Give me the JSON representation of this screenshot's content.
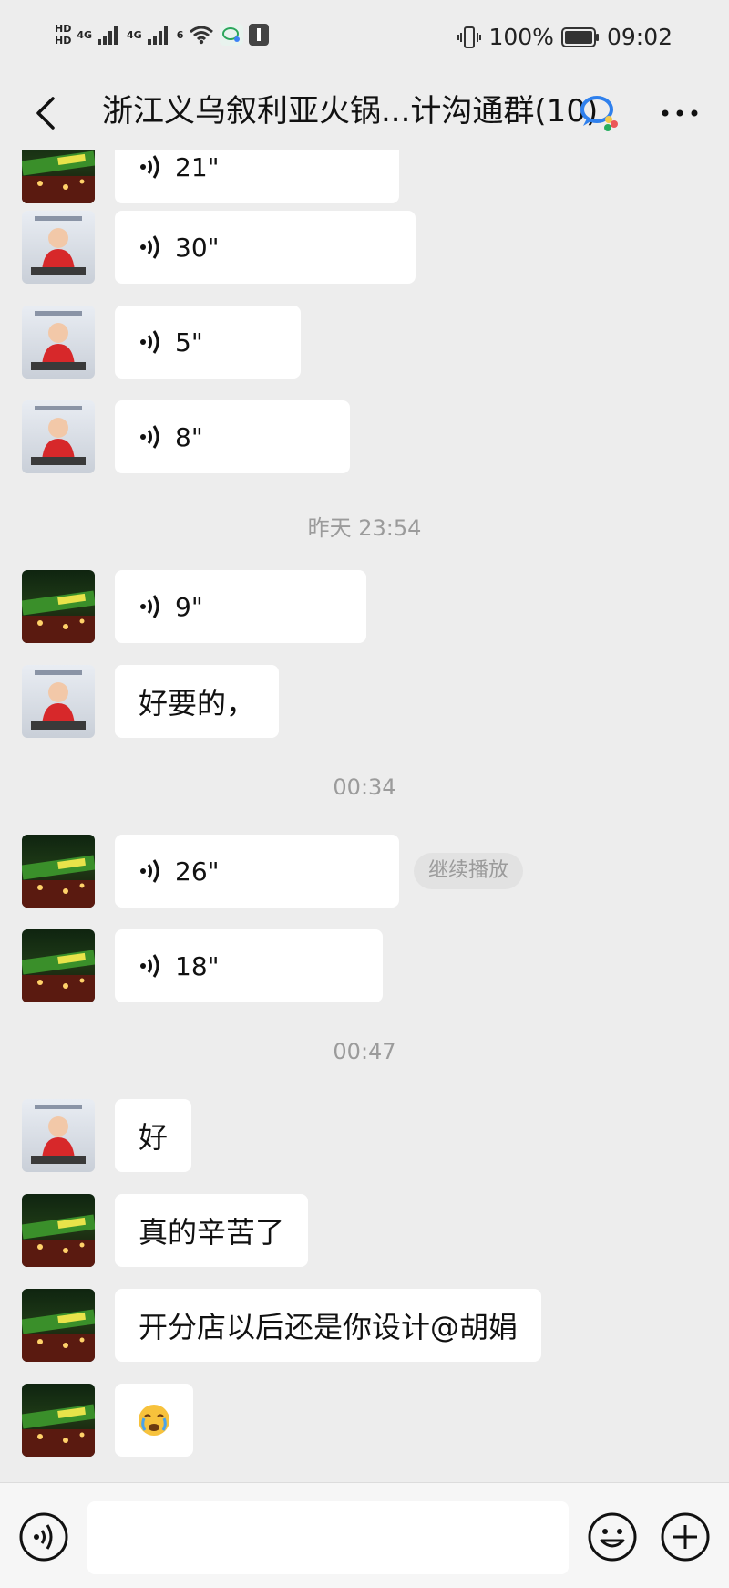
{
  "status_bar": {
    "hd1": "HD",
    "hd2": "HD",
    "net1": "4G",
    "net2": "4G",
    "wifi_badge": "6",
    "battery": "100%",
    "time": "09:02"
  },
  "header": {
    "title": "浙江义乌叙利亚火锅...计沟通群(10)"
  },
  "messages": [
    {
      "sender": "restaurant",
      "kind": "voice",
      "duration": "21\""
    },
    {
      "sender": "baby",
      "kind": "voice",
      "duration": "30\""
    },
    {
      "sender": "baby",
      "kind": "voice",
      "duration": "5\""
    },
    {
      "sender": "baby",
      "kind": "voice",
      "duration": "8\""
    },
    {
      "kind": "time",
      "text": "昨天 23:54"
    },
    {
      "sender": "restaurant",
      "kind": "voice",
      "duration": "9\""
    },
    {
      "sender": "baby",
      "kind": "text",
      "text": "好要的，"
    },
    {
      "kind": "time",
      "text": "00:34"
    },
    {
      "sender": "restaurant",
      "kind": "voice",
      "duration": "26\"",
      "action": "继续播放"
    },
    {
      "sender": "restaurant",
      "kind": "voice",
      "duration": "18\""
    },
    {
      "kind": "time",
      "text": "00:47"
    },
    {
      "sender": "baby",
      "kind": "text",
      "text": "好"
    },
    {
      "sender": "restaurant",
      "kind": "text",
      "text": "真的辛苦了"
    },
    {
      "sender": "restaurant",
      "kind": "text",
      "text": "开分店以后还是你设计@胡娟"
    },
    {
      "sender": "restaurant",
      "kind": "emoji",
      "text": "😭"
    }
  ],
  "input_bar": {
    "voice_icon": "voice-mode-icon",
    "emoji_icon": "emoji-icon",
    "plus_icon": "plus-icon"
  }
}
